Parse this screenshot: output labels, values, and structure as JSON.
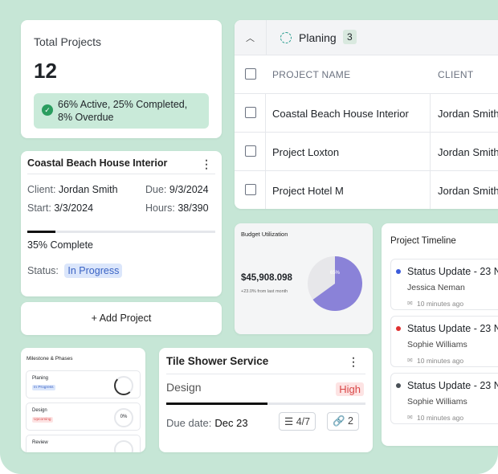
{
  "totals": {
    "title": "Total Projects",
    "count": "12",
    "summary_line1": "66% Active, 25% Completed,",
    "summary_line2": "8% Overdue"
  },
  "table": {
    "group_label": "Planing",
    "group_count": "3",
    "columns": [
      "PROJECT NAME",
      "CLIENT"
    ],
    "rows": [
      {
        "name": "Coastal Beach House Interior",
        "client": "Jordan Smith"
      },
      {
        "name": "Project Loxton",
        "client": "Jordan Smith"
      },
      {
        "name": "Project Hotel M",
        "client": "Jordan Smith"
      }
    ]
  },
  "detail": {
    "title": "Coastal Beach House Interior",
    "client_label": "Client:",
    "client": "Jordan Smith",
    "due_label": "Due:",
    "due": "9/3/2024",
    "start_label": "Start:",
    "start": "3/3/2024",
    "hours_label": "Hours:",
    "hours": "38/390",
    "progress_pct": 35,
    "progress_text": "35% Complete",
    "status_label": "Status:",
    "status": "In Progress"
  },
  "add_project": "+ Add Project",
  "budget": {
    "title": "Budget Utilization",
    "amount": "$45,908.098",
    "change": "+23.0% from last month",
    "pie_pct": 65,
    "pie_label": "65%",
    "pie_color": "#8a82d8",
    "pie_rest_color": "#e7e7ea"
  },
  "timeline": {
    "title": "Project Timeline",
    "items": [
      {
        "heading": "Status Update - 23 N",
        "name": "Jessica Neman",
        "ago": "10 minutes ago",
        "dot": "#3b5bdb"
      },
      {
        "heading": "Status Update - 23 N",
        "name": "Sophie Williams",
        "ago": "10 minutes ago",
        "dot": "#e03131"
      },
      {
        "heading": "Status Update - 23 N",
        "name": "Sophie Williams",
        "ago": "10 minutes ago",
        "dot": "#495057"
      }
    ]
  },
  "milestones": {
    "title": "Milestone & Phases",
    "items": [
      {
        "name": "Planing",
        "tag": "In Progress",
        "value": ""
      },
      {
        "name": "Design",
        "tag": "Upcoming",
        "value": "0%"
      },
      {
        "name": "Review",
        "tag": "",
        "value": ""
      }
    ]
  },
  "tile": {
    "title": "Tile Shower Service",
    "phase": "Design",
    "priority": "High",
    "progress_pct": 60,
    "due_label": "Due date:",
    "due": "Dec 23",
    "tasks": "4/7",
    "attachments": "2"
  }
}
